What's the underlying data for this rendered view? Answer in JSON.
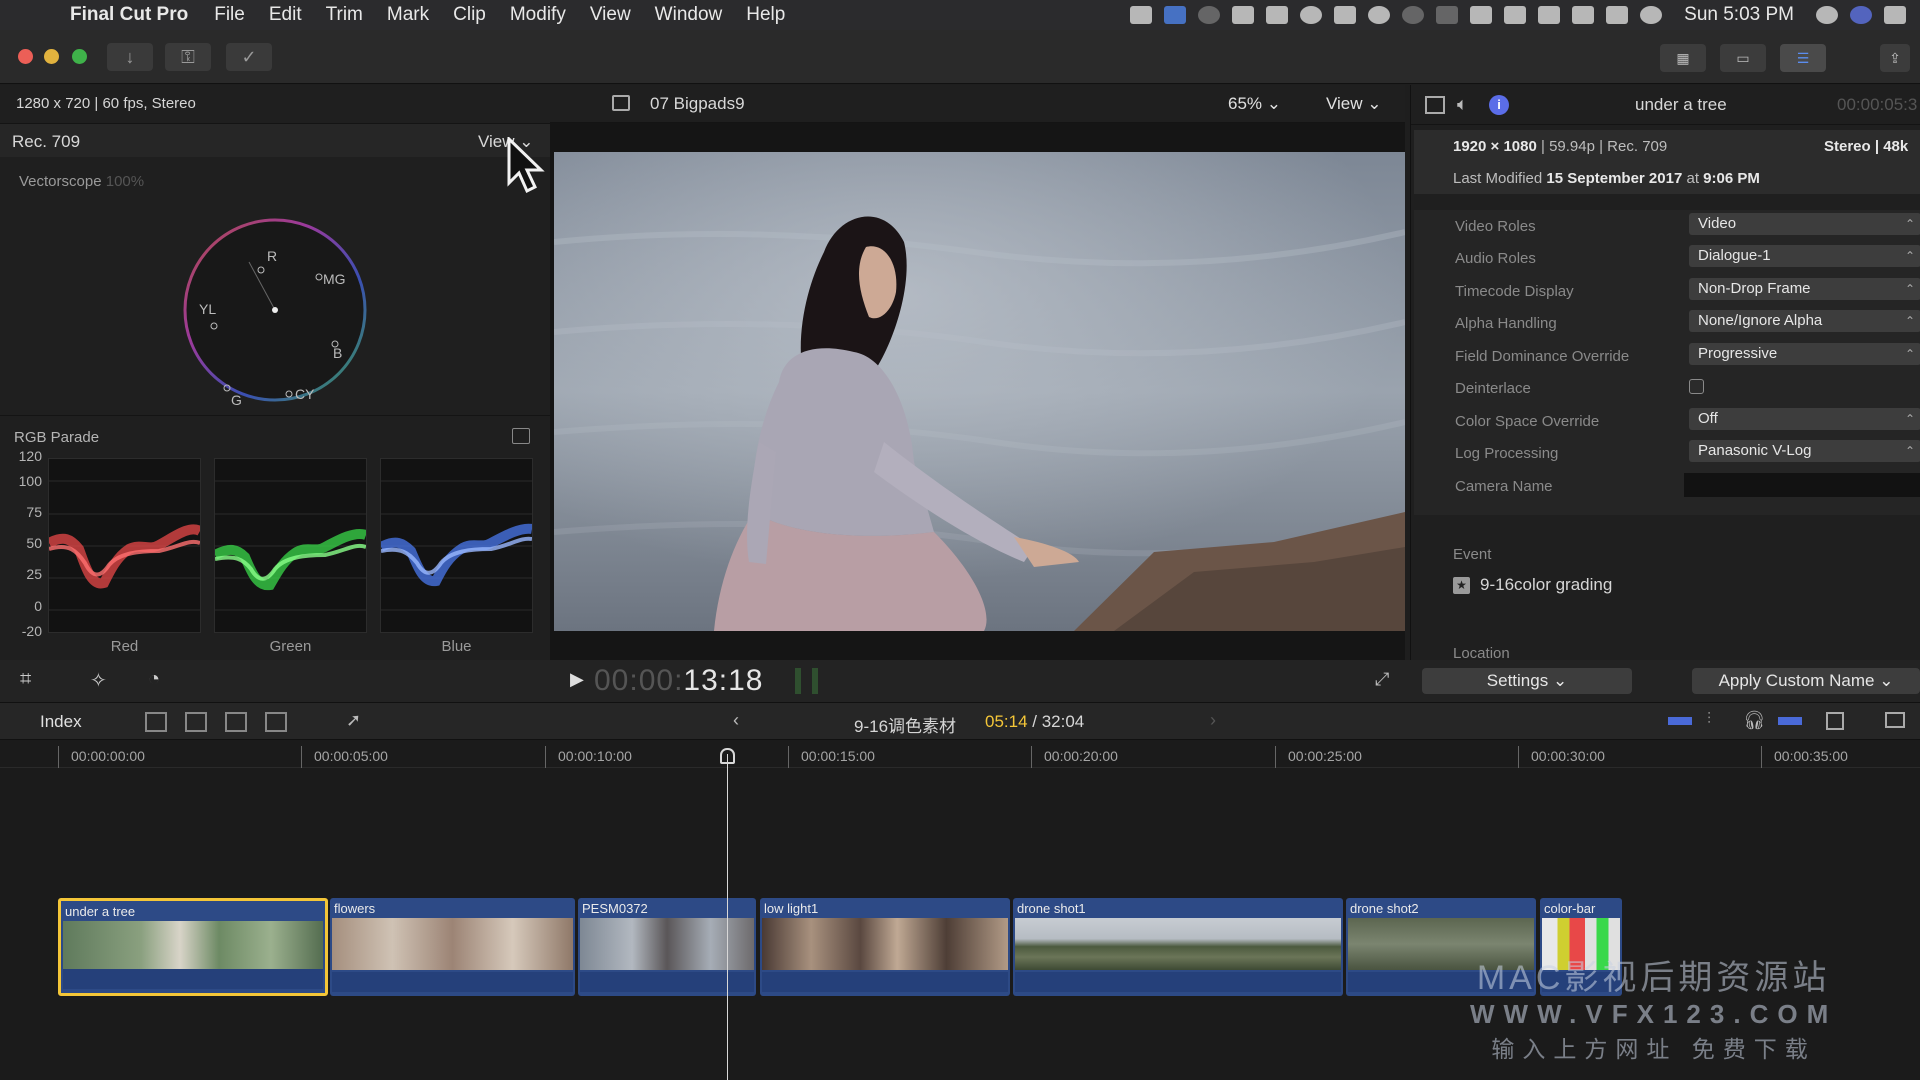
{
  "menubar": {
    "app_name": "Final Cut Pro",
    "menus": [
      "File",
      "Edit",
      "Trim",
      "Mark",
      "Clip",
      "Modify",
      "View",
      "Window",
      "Help"
    ],
    "clock": "Sun 5:03 PM"
  },
  "scopes": {
    "format_info": "1280 x 720 | 60 fps, Stereo",
    "color_space": "Rec. 709",
    "view_label": "View",
    "vectorscope_label": "Vectorscope",
    "vectorscope_pct": "100%",
    "vector_targets": [
      "R",
      "MG",
      "YL",
      "B",
      "G",
      "CY"
    ],
    "parade_label": "RGB Parade",
    "parade_scale": [
      "120",
      "100",
      "75",
      "50",
      "25",
      "0",
      "-20"
    ],
    "parade_channels": [
      "Red",
      "Green",
      "Blue"
    ]
  },
  "viewer": {
    "clip_title": "07 Bigpads9",
    "zoom": "65%",
    "view_label": "View",
    "timecode_dim": "00:00:",
    "timecode": "13:18"
  },
  "inspector": {
    "clip_name": "under a tree",
    "timecode": "00:00:05:3",
    "resolution": "1920 × 1080",
    "format_rest": " | 59.94p | Rec. 709",
    "channels": "Stereo | 48k",
    "last_modified_label": "Last Modified ",
    "last_modified_date": "15 September 2017",
    "last_modified_at": " at ",
    "last_modified_time": "9:06 PM",
    "properties": [
      {
        "label": "Video Roles",
        "value": "Video",
        "kind": "popup"
      },
      {
        "label": "Audio Roles",
        "value": "Dialogue-1",
        "kind": "popup"
      },
      {
        "label": "Timecode Display",
        "value": "Non-Drop Frame",
        "kind": "popup"
      },
      {
        "label": "Alpha Handling",
        "value": "None/Ignore Alpha",
        "kind": "popup"
      },
      {
        "label": "Field Dominance Override",
        "value": "Progressive",
        "kind": "popup"
      },
      {
        "label": "Deinterlace",
        "value": "",
        "kind": "checkbox"
      },
      {
        "label": "Color Space Override",
        "value": "Off",
        "kind": "popup"
      },
      {
        "label": "Log Processing",
        "value": "Panasonic V-Log",
        "kind": "popup"
      },
      {
        "label": "Camera Name",
        "value": "",
        "kind": "field"
      }
    ],
    "event_label": "Event",
    "event_name": "9-16color grading",
    "location_label": "Location",
    "settings_button": "Settings",
    "apply_button": "Apply Custom Name"
  },
  "timeline": {
    "index_label": "Index",
    "project_name": "9-16调色素材",
    "position": "05:14",
    "duration": " / 32:04",
    "ruler": [
      "00:00:00:00",
      "00:00:05:00",
      "00:00:10:00",
      "00:00:15:00",
      "00:00:20:00",
      "00:00:25:00",
      "00:00:30:00",
      "00:00:35:00"
    ],
    "clips": [
      {
        "name": "under a tree",
        "selected": true
      },
      {
        "name": "flowers",
        "selected": false
      },
      {
        "name": "PESM0372",
        "selected": false
      },
      {
        "name": "low light1",
        "selected": false
      },
      {
        "name": "drone shot1",
        "selected": false
      },
      {
        "name": "drone shot2",
        "selected": false
      },
      {
        "name": "color-bar",
        "selected": false
      }
    ]
  },
  "watermark": {
    "line1": "MAC影视后期资源站",
    "line2": "WWW.VFX123.COM",
    "line3": "输入上方网址 免费下载"
  }
}
